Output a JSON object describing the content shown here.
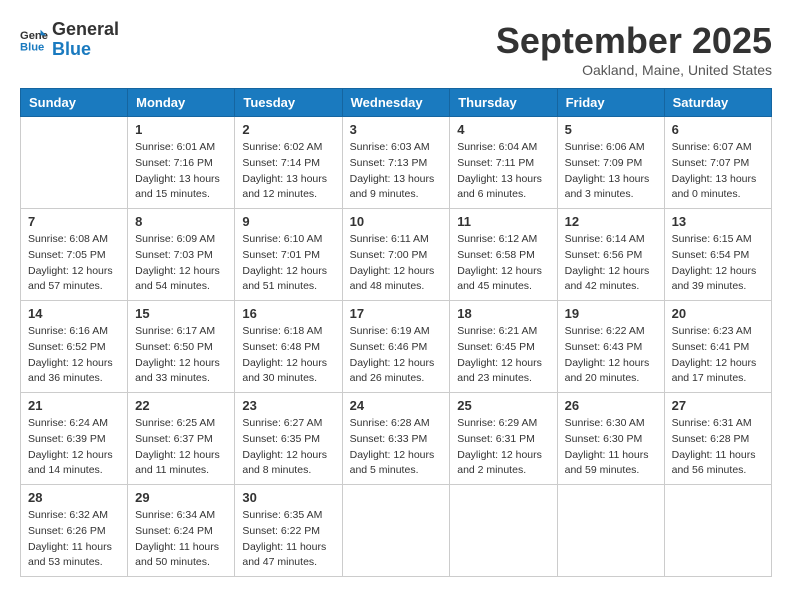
{
  "logo": {
    "line1": "General",
    "line2": "Blue"
  },
  "title": "September 2025",
  "location": "Oakland, Maine, United States",
  "days_header": [
    "Sunday",
    "Monday",
    "Tuesday",
    "Wednesday",
    "Thursday",
    "Friday",
    "Saturday"
  ],
  "weeks": [
    [
      {
        "day": "",
        "info": ""
      },
      {
        "day": "1",
        "info": "Sunrise: 6:01 AM\nSunset: 7:16 PM\nDaylight: 13 hours\nand 15 minutes."
      },
      {
        "day": "2",
        "info": "Sunrise: 6:02 AM\nSunset: 7:14 PM\nDaylight: 13 hours\nand 12 minutes."
      },
      {
        "day": "3",
        "info": "Sunrise: 6:03 AM\nSunset: 7:13 PM\nDaylight: 13 hours\nand 9 minutes."
      },
      {
        "day": "4",
        "info": "Sunrise: 6:04 AM\nSunset: 7:11 PM\nDaylight: 13 hours\nand 6 minutes."
      },
      {
        "day": "5",
        "info": "Sunrise: 6:06 AM\nSunset: 7:09 PM\nDaylight: 13 hours\nand 3 minutes."
      },
      {
        "day": "6",
        "info": "Sunrise: 6:07 AM\nSunset: 7:07 PM\nDaylight: 13 hours\nand 0 minutes."
      }
    ],
    [
      {
        "day": "7",
        "info": "Sunrise: 6:08 AM\nSunset: 7:05 PM\nDaylight: 12 hours\nand 57 minutes."
      },
      {
        "day": "8",
        "info": "Sunrise: 6:09 AM\nSunset: 7:03 PM\nDaylight: 12 hours\nand 54 minutes."
      },
      {
        "day": "9",
        "info": "Sunrise: 6:10 AM\nSunset: 7:01 PM\nDaylight: 12 hours\nand 51 minutes."
      },
      {
        "day": "10",
        "info": "Sunrise: 6:11 AM\nSunset: 7:00 PM\nDaylight: 12 hours\nand 48 minutes."
      },
      {
        "day": "11",
        "info": "Sunrise: 6:12 AM\nSunset: 6:58 PM\nDaylight: 12 hours\nand 45 minutes."
      },
      {
        "day": "12",
        "info": "Sunrise: 6:14 AM\nSunset: 6:56 PM\nDaylight: 12 hours\nand 42 minutes."
      },
      {
        "day": "13",
        "info": "Sunrise: 6:15 AM\nSunset: 6:54 PM\nDaylight: 12 hours\nand 39 minutes."
      }
    ],
    [
      {
        "day": "14",
        "info": "Sunrise: 6:16 AM\nSunset: 6:52 PM\nDaylight: 12 hours\nand 36 minutes."
      },
      {
        "day": "15",
        "info": "Sunrise: 6:17 AM\nSunset: 6:50 PM\nDaylight: 12 hours\nand 33 minutes."
      },
      {
        "day": "16",
        "info": "Sunrise: 6:18 AM\nSunset: 6:48 PM\nDaylight: 12 hours\nand 30 minutes."
      },
      {
        "day": "17",
        "info": "Sunrise: 6:19 AM\nSunset: 6:46 PM\nDaylight: 12 hours\nand 26 minutes."
      },
      {
        "day": "18",
        "info": "Sunrise: 6:21 AM\nSunset: 6:45 PM\nDaylight: 12 hours\nand 23 minutes."
      },
      {
        "day": "19",
        "info": "Sunrise: 6:22 AM\nSunset: 6:43 PM\nDaylight: 12 hours\nand 20 minutes."
      },
      {
        "day": "20",
        "info": "Sunrise: 6:23 AM\nSunset: 6:41 PM\nDaylight: 12 hours\nand 17 minutes."
      }
    ],
    [
      {
        "day": "21",
        "info": "Sunrise: 6:24 AM\nSunset: 6:39 PM\nDaylight: 12 hours\nand 14 minutes."
      },
      {
        "day": "22",
        "info": "Sunrise: 6:25 AM\nSunset: 6:37 PM\nDaylight: 12 hours\nand 11 minutes."
      },
      {
        "day": "23",
        "info": "Sunrise: 6:27 AM\nSunset: 6:35 PM\nDaylight: 12 hours\nand 8 minutes."
      },
      {
        "day": "24",
        "info": "Sunrise: 6:28 AM\nSunset: 6:33 PM\nDaylight: 12 hours\nand 5 minutes."
      },
      {
        "day": "25",
        "info": "Sunrise: 6:29 AM\nSunset: 6:31 PM\nDaylight: 12 hours\nand 2 minutes."
      },
      {
        "day": "26",
        "info": "Sunrise: 6:30 AM\nSunset: 6:30 PM\nDaylight: 11 hours\nand 59 minutes."
      },
      {
        "day": "27",
        "info": "Sunrise: 6:31 AM\nSunset: 6:28 PM\nDaylight: 11 hours\nand 56 minutes."
      }
    ],
    [
      {
        "day": "28",
        "info": "Sunrise: 6:32 AM\nSunset: 6:26 PM\nDaylight: 11 hours\nand 53 minutes."
      },
      {
        "day": "29",
        "info": "Sunrise: 6:34 AM\nSunset: 6:24 PM\nDaylight: 11 hours\nand 50 minutes."
      },
      {
        "day": "30",
        "info": "Sunrise: 6:35 AM\nSunset: 6:22 PM\nDaylight: 11 hours\nand 47 minutes."
      },
      {
        "day": "",
        "info": ""
      },
      {
        "day": "",
        "info": ""
      },
      {
        "day": "",
        "info": ""
      },
      {
        "day": "",
        "info": ""
      }
    ]
  ]
}
